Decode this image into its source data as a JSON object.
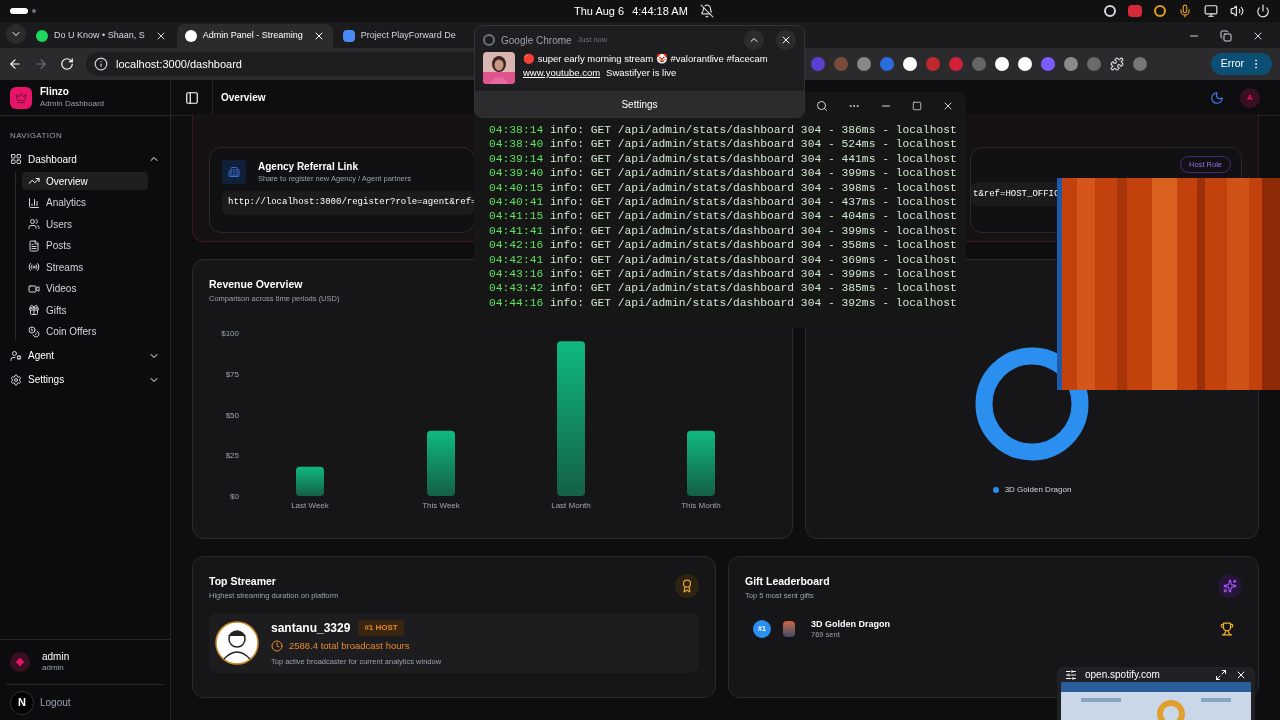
{
  "system_bar": {
    "date": "Thu Aug 6",
    "time": "4:44:18 AM"
  },
  "browser": {
    "tabs": [
      {
        "title": "Do U Know • Shaan, S",
        "selected": false
      },
      {
        "title": "Admin Panel - Streaming",
        "selected": true
      },
      {
        "title": "Project PlayForward De",
        "selected": false
      }
    ],
    "url": "localhost:3000/dashboard",
    "error_button": "Error"
  },
  "notification": {
    "app": "Google Chrome",
    "time": "Just now",
    "message": "🔴 super early morning stream 🤡 #valorantlive #facecam",
    "link": "www.youtube.com",
    "detail": "Swastifyer is live",
    "settings": "Settings"
  },
  "sidebar": {
    "brand": "Flinzo",
    "subtitle": "Admin Dashboard",
    "section": "NAVIGATION",
    "items": [
      {
        "label": "Dashboard",
        "expanded": true,
        "children": [
          {
            "label": "Overview",
            "selected": true
          },
          {
            "label": "Analytics",
            "selected": false
          },
          {
            "label": "Users",
            "selected": false
          },
          {
            "label": "Posts",
            "selected": false
          },
          {
            "label": "Streams",
            "selected": false
          },
          {
            "label": "Videos",
            "selected": false
          },
          {
            "label": "Gifts",
            "selected": false
          },
          {
            "label": "Coin Offers",
            "selected": false
          }
        ]
      },
      {
        "label": "Agent",
        "expanded": false
      },
      {
        "label": "Settings",
        "expanded": false
      }
    ],
    "user": {
      "name": "admin",
      "role": "admin"
    },
    "logout": "Logout",
    "dev_badge": "N"
  },
  "header": {
    "title": "Overview",
    "avatar": "A"
  },
  "referral": {
    "agency": {
      "title": "Agency Referral Link",
      "subtitle": "Share to register new Agency / Agent partners",
      "url": "http://localhost:3000/register?role=agent&ref="
    },
    "host": {
      "badge": "Host Role",
      "url": "t&ref=HOST_OFFIC"
    }
  },
  "terminal": {
    "lines": [
      {
        "time": "04:38:14",
        "text": "info: GET /api/admin/stats/dashboard 304 - 386ms - localhost"
      },
      {
        "time": "04:38:40",
        "text": "info: GET /api/admin/stats/dashboard 304 - 524ms - localhost"
      },
      {
        "time": "04:39:14",
        "text": "info: GET /api/admin/stats/dashboard 304 - 441ms - localhost"
      },
      {
        "time": "04:39:40",
        "text": "info: GET /api/admin/stats/dashboard 304 - 399ms - localhost"
      },
      {
        "time": "04:40:15",
        "text": "info: GET /api/admin/stats/dashboard 304 - 398ms - localhost"
      },
      {
        "time": "04:40:41",
        "text": "info: GET /api/admin/stats/dashboard 304 - 437ms - localhost"
      },
      {
        "time": "04:41:15",
        "text": "info: GET /api/admin/stats/dashboard 304 - 404ms - localhost"
      },
      {
        "time": "04:41:41",
        "text": "info: GET /api/admin/stats/dashboard 304 - 399ms - localhost"
      },
      {
        "time": "04:42:16",
        "text": "info: GET /api/admin/stats/dashboard 304 - 358ms - localhost"
      },
      {
        "time": "04:42:41",
        "text": "info: GET /api/admin/stats/dashboard 304 - 369ms - localhost"
      },
      {
        "time": "04:43:16",
        "text": "info: GET /api/admin/stats/dashboard 304 - 399ms - localhost"
      },
      {
        "time": "04:43:42",
        "text": "info: GET /api/admin/stats/dashboard 304 - 385ms - localhost"
      },
      {
        "time": "04:44:16",
        "text": "info: GET /api/admin/stats/dashboard 304 - 392ms - localhost"
      }
    ]
  },
  "revenue": {
    "title": "Revenue Overview",
    "subtitle": "Comparison across time periods (USD)",
    "chart_data": {
      "type": "bar",
      "categories": [
        "Last Week",
        "This Week",
        "Last Month",
        "This Month"
      ],
      "series": [
        {
          "color": "#10b981",
          "values": [
            18,
            40,
            95,
            40
          ]
        }
      ],
      "ylim": [
        0,
        100
      ],
      "yticks": [
        {
          "value": 0,
          "label": "$0"
        },
        {
          "value": 25,
          "label": "$25"
        },
        {
          "value": 50,
          "label": "$50"
        },
        {
          "value": 75,
          "label": "$75"
        },
        {
          "value": 100,
          "label": "$100"
        }
      ]
    }
  },
  "gifts_distribution": {
    "legend": [
      {
        "label": "3D Golden Dragon",
        "color": "#2b8ff0"
      }
    ]
  },
  "top_streamer": {
    "title": "Top Streamer",
    "subtitle": "Highest streaming duration on platform",
    "name": "santanu_3329",
    "badge": "#1 HOST",
    "hours": "2588.4 total broadcast hours",
    "note": "Top active broadcaster for current analytics window"
  },
  "gift_leaderboard": {
    "title": "Gift Leaderboard",
    "subtitle": "Top 5 most sent gifts",
    "entries": [
      {
        "rank": "#1",
        "name": "3D Golden Dragon",
        "count": "769 sent"
      }
    ]
  },
  "mini_player": {
    "site": "open.spotify.com"
  }
}
